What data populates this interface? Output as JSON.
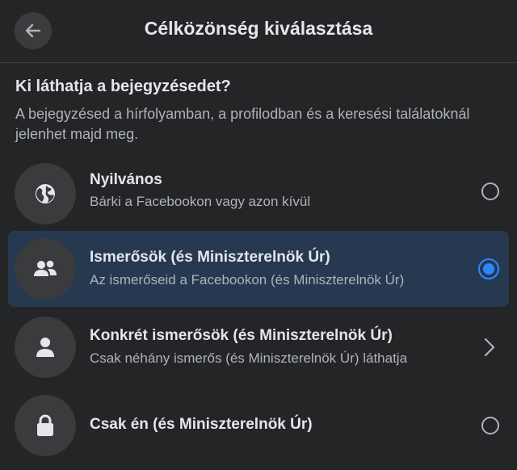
{
  "header": {
    "title": "Célközönség kiválasztása",
    "back_icon": "arrow-left-icon"
  },
  "question": "Ki láthatja a bejegyzésedet?",
  "description": "A bejegyzésed a hírfolyamban, a profilodban és a keresési találatoknál jelenhet majd meg.",
  "options": [
    {
      "icon": "globe-icon",
      "title": "Nyilvános",
      "subtitle": "Bárki a Facebookon vagy azon kívül",
      "control": "radio",
      "selected": false
    },
    {
      "icon": "friends-icon",
      "title": "Ismerősök (és Miniszterelnök Úr)",
      "subtitle": "Az ismerőseid a Facebookon (és Miniszterelnök Úr)",
      "control": "radio",
      "selected": true
    },
    {
      "icon": "person-icon",
      "title": "Konkrét ismerősök (és Miniszterelnök Úr)",
      "subtitle": "Csak néhány ismerős (és Miniszterelnök Úr) láthatja",
      "control": "chevron",
      "selected": false
    },
    {
      "icon": "lock-icon",
      "title": "Csak én (és Miniszterelnök Úr)",
      "subtitle": "",
      "control": "radio",
      "selected": false
    }
  ],
  "colors": {
    "background": "#242526",
    "selected_row": "#263951",
    "accent": "#2d88ff",
    "icon_circle": "#3a3b3c"
  }
}
